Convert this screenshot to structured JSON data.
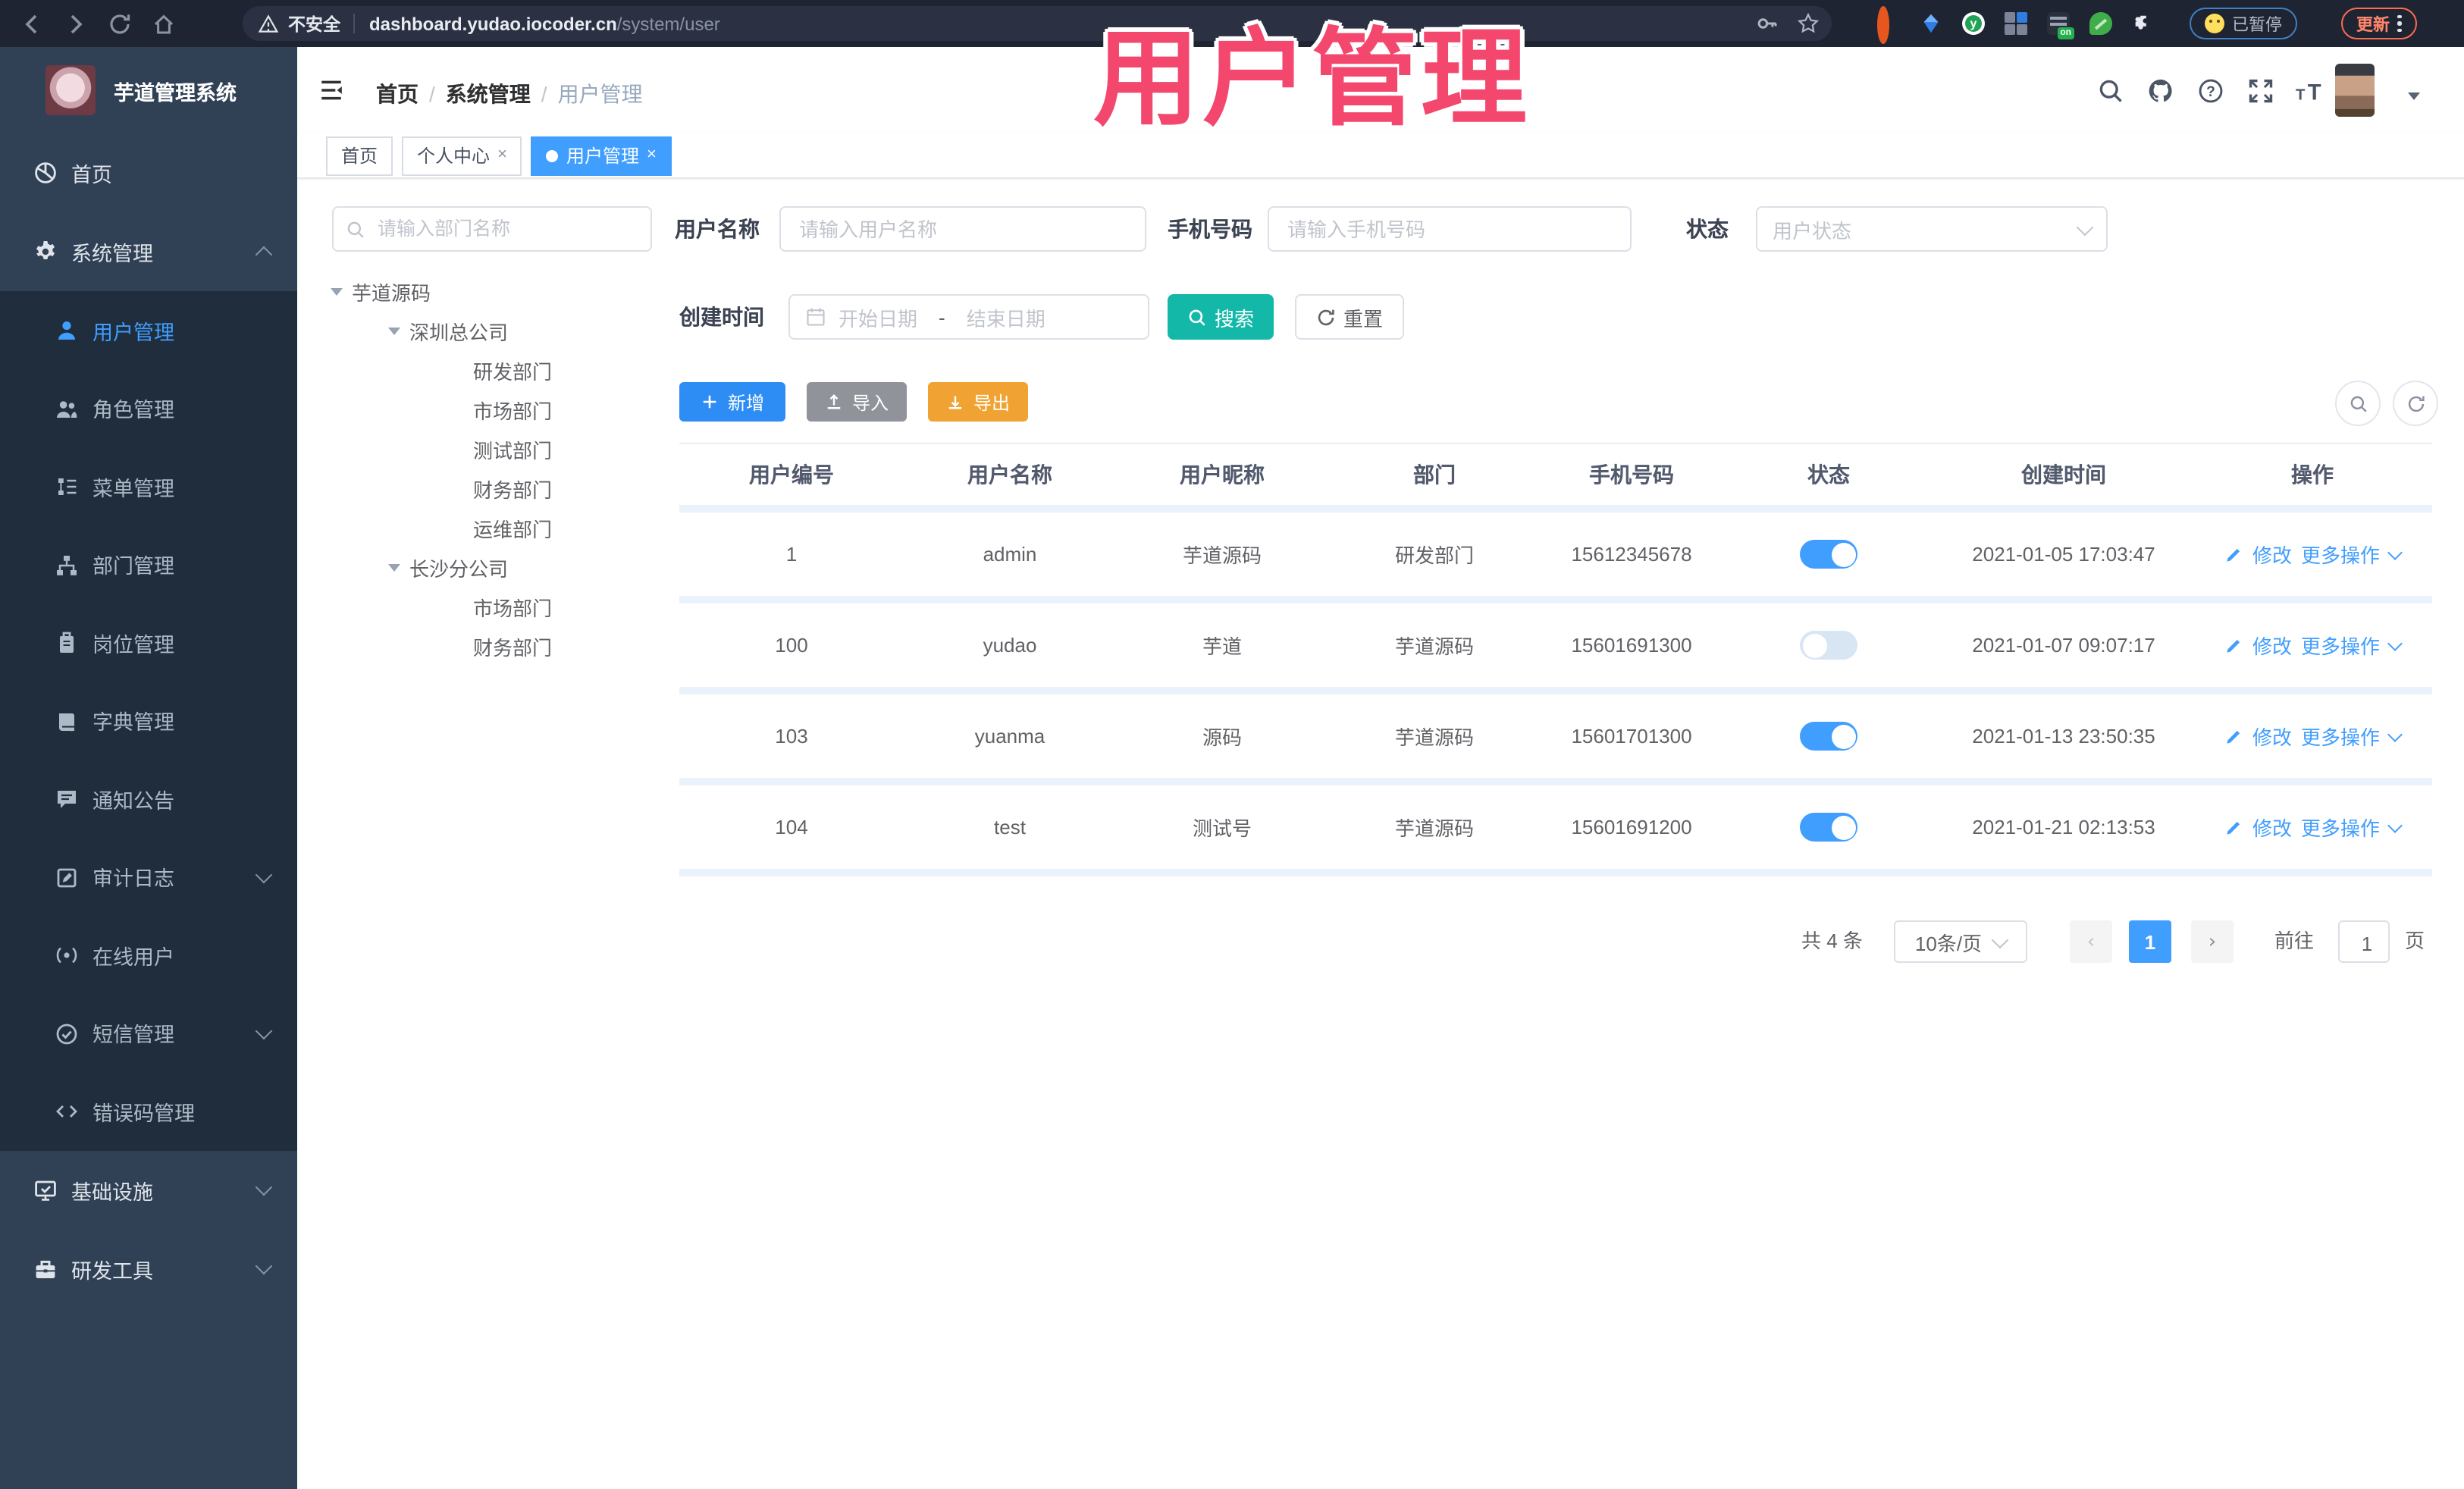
{
  "browser": {
    "security_label": "不安全",
    "url_domain": "dashboard.yudao.iocoder.cn",
    "url_path": "/system/user",
    "paused_badge": "已暂停",
    "update_button": "更新"
  },
  "overlay_title": "用户管理",
  "sidebar": {
    "app_title": "芋道管理系统",
    "items": [
      {
        "label": "首页",
        "icon": "dashboard-icon",
        "type": "root"
      },
      {
        "label": "系统管理",
        "icon": "gear-icon",
        "type": "root",
        "chevron": "up"
      },
      {
        "label": "用户管理",
        "icon": "user-icon",
        "type": "sub",
        "active": true
      },
      {
        "label": "角色管理",
        "icon": "users-icon",
        "type": "sub"
      },
      {
        "label": "菜单管理",
        "icon": "menu-tree-icon",
        "type": "sub"
      },
      {
        "label": "部门管理",
        "icon": "org-tree-icon",
        "type": "sub"
      },
      {
        "label": "岗位管理",
        "icon": "badge-icon",
        "type": "sub"
      },
      {
        "label": "字典管理",
        "icon": "book-icon",
        "type": "sub"
      },
      {
        "label": "通知公告",
        "icon": "message-icon",
        "type": "sub"
      },
      {
        "label": "审计日志",
        "icon": "log-icon",
        "type": "sub",
        "chevron": "down"
      },
      {
        "label": "在线用户",
        "icon": "online-icon",
        "type": "sub"
      },
      {
        "label": "短信管理",
        "icon": "check-circle-icon",
        "type": "sub",
        "chevron": "down"
      },
      {
        "label": "错误码管理",
        "icon": "code-icon",
        "type": "sub"
      },
      {
        "label": "基础设施",
        "icon": "monitor-icon",
        "type": "root",
        "chevron": "down"
      },
      {
        "label": "研发工具",
        "icon": "toolbox-icon",
        "type": "root",
        "chevron": "down"
      }
    ]
  },
  "header": {
    "breadcrumb": [
      "首页",
      "系统管理",
      "用户管理"
    ],
    "tabs": [
      {
        "label": "首页",
        "active": false,
        "closable": false
      },
      {
        "label": "个人中心",
        "active": false,
        "closable": true
      },
      {
        "label": "用户管理",
        "active": true,
        "closable": true
      }
    ]
  },
  "dept_panel": {
    "search_placeholder": "请输入部门名称",
    "tree": [
      {
        "label": "芋道源码",
        "level": 0,
        "expand": true
      },
      {
        "label": "深圳总公司",
        "level": 1,
        "expand": true
      },
      {
        "label": "研发部门",
        "level": 2
      },
      {
        "label": "市场部门",
        "level": 2
      },
      {
        "label": "测试部门",
        "level": 2
      },
      {
        "label": "财务部门",
        "level": 2
      },
      {
        "label": "运维部门",
        "level": 2
      },
      {
        "label": "长沙分公司",
        "level": 1,
        "expand": true
      },
      {
        "label": "市场部门",
        "level": 2
      },
      {
        "label": "财务部门",
        "level": 2
      }
    ]
  },
  "filters": {
    "username_label": "用户名称",
    "username_placeholder": "请输入用户名称",
    "mobile_label": "手机号码",
    "mobile_placeholder": "请输入手机号码",
    "status_label": "状态",
    "status_placeholder": "用户状态",
    "created_label": "创建时间",
    "date_start_placeholder": "开始日期",
    "date_separator": "-",
    "date_end_placeholder": "结束日期",
    "search_button": "搜索",
    "reset_button": "重置"
  },
  "toolbar": {
    "add_button": "新增",
    "import_button": "导入",
    "export_button": "导出"
  },
  "table": {
    "columns": [
      "用户编号",
      "用户名称",
      "用户昵称",
      "部门",
      "手机号码",
      "状态",
      "创建时间",
      "操作"
    ],
    "edit_action": "修改",
    "more_action": "更多操作",
    "rows": [
      {
        "id": "1",
        "username": "admin",
        "nickname": "芋道源码",
        "dept": "研发部门",
        "mobile": "15612345678",
        "status": true,
        "created": "2021-01-05 17:03:47"
      },
      {
        "id": "100",
        "username": "yudao",
        "nickname": "芋道",
        "dept": "芋道源码",
        "mobile": "15601691300",
        "status": false,
        "created": "2021-01-07 09:07:17"
      },
      {
        "id": "103",
        "username": "yuanma",
        "nickname": "源码",
        "dept": "芋道源码",
        "mobile": "15601701300",
        "status": true,
        "created": "2021-01-13 23:50:35"
      },
      {
        "id": "104",
        "username": "test",
        "nickname": "测试号",
        "dept": "芋道源码",
        "mobile": "15601691200",
        "status": true,
        "created": "2021-01-21 02:13:53"
      }
    ]
  },
  "pagination": {
    "total_text": "共 4 条",
    "page_size": "10条/页",
    "current_page": "1",
    "goto_label": "前往",
    "goto_value": "1",
    "page_unit": "页"
  },
  "colors": {
    "accent_blue": "#409eff",
    "teal_search": "#13b8a8",
    "orange_export": "#f0a332",
    "grey_import": "#909399",
    "blue_add": "#2e8df4",
    "pink_overlay": "#f4476e",
    "sidebar_bg": "#304156",
    "sidebar_sub_bg": "#1f2d3d"
  }
}
